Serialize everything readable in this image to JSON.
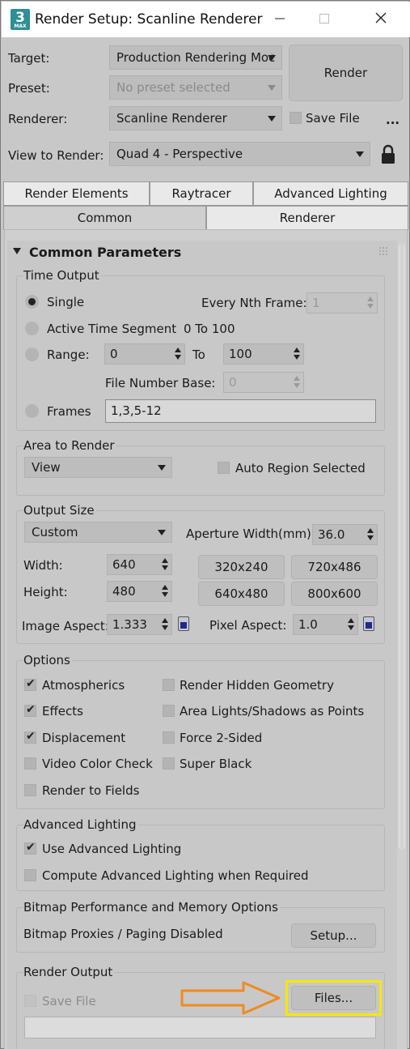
{
  "window": {
    "app_icon": "3",
    "app_icon_sub": "MAX",
    "title": "Render Setup: Scanline Renderer",
    "minimize_icon": "minimize-icon",
    "maximize_icon": "maximize-icon",
    "close_icon": "close-icon"
  },
  "header": {
    "target_label": "Target:",
    "target_value": "Production Rendering Moc",
    "preset_label": "Preset:",
    "preset_value": "No preset selected",
    "renderer_label": "Renderer:",
    "renderer_value": "Scanline Renderer",
    "render_button": "Render",
    "save_file_label": "Save File",
    "save_file_checked": false,
    "more_button": "...",
    "view_label": "View to Render:",
    "view_value": "Quad 4 - Perspective",
    "lock_icon": "lock-icon"
  },
  "tabs": {
    "row1": [
      "Render Elements",
      "Raytracer",
      "Advanced Lighting"
    ],
    "row2": [
      "Common",
      "Renderer"
    ],
    "active": "Common"
  },
  "rollout": {
    "title": "Common Parameters",
    "collapse_icon": "triangle-down-icon",
    "time_output": {
      "title": "Time Output",
      "single": "Single",
      "every_nth_label": "Every Nth Frame:",
      "every_nth_value": "1",
      "active_segment": "Active Time Segment",
      "active_segment_range": "0 To 100",
      "range": "Range:",
      "range_from": "0",
      "range_to_label": "To",
      "range_to": "100",
      "file_number_base_label": "File Number Base:",
      "file_number_base": "0",
      "frames": "Frames",
      "frames_value": "1,3,5-12",
      "selected": "single"
    },
    "area_to_render": {
      "title": "Area to Render",
      "value": "View",
      "auto_region": "Auto Region Selected",
      "auto_region_checked": false
    },
    "output_size": {
      "title": "Output Size",
      "preset": "Custom",
      "aperture_label": "Aperture Width(mm):",
      "aperture_value": "36.0",
      "width_label": "Width:",
      "width_value": "640",
      "height_label": "Height:",
      "height_value": "480",
      "presets": [
        "320x240",
        "720x486",
        "640x480",
        "800x600"
      ],
      "image_aspect_label": "Image Aspect:",
      "image_aspect_value": "1.333",
      "pixel_aspect_label": "Pixel Aspect:",
      "pixel_aspect_value": "1.0"
    },
    "options": {
      "title": "Options",
      "left": [
        {
          "label": "Atmospherics",
          "checked": true
        },
        {
          "label": "Effects",
          "checked": true
        },
        {
          "label": "Displacement",
          "checked": true
        },
        {
          "label": "Video Color Check",
          "checked": false
        },
        {
          "label": "Render to Fields",
          "checked": false
        }
      ],
      "right": [
        {
          "label": "Render Hidden Geometry",
          "checked": false
        },
        {
          "label": "Area Lights/Shadows as Points",
          "checked": false
        },
        {
          "label": "Force 2-Sided",
          "checked": false
        },
        {
          "label": "Super Black",
          "checked": false
        }
      ]
    },
    "advanced_lighting": {
      "title": "Advanced Lighting",
      "use": "Use Advanced Lighting",
      "use_checked": true,
      "compute": "Compute Advanced Lighting when Required",
      "compute_checked": false
    },
    "bitmap": {
      "title": "Bitmap Performance and Memory Options",
      "status": "Bitmap Proxies / Paging Disabled",
      "setup_button": "Setup..."
    },
    "render_output": {
      "title": "Render Output",
      "save_file": "Save File",
      "files_button": "Files...",
      "path_value": ""
    }
  },
  "annotation": {
    "highlight_color": "#f5e800",
    "arrow_color": "#f08a1e"
  }
}
